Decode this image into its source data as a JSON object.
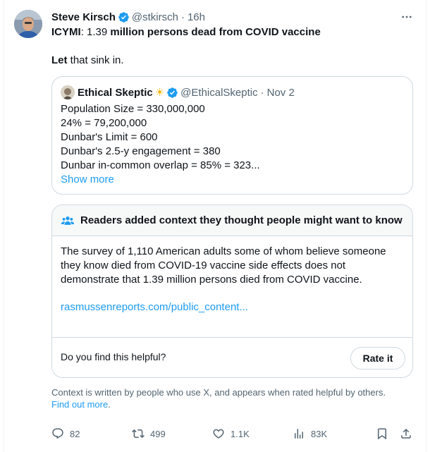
{
  "tweet": {
    "author_name": "Steve Kirsch",
    "handle": "@stkirsch",
    "separator": "·",
    "time": "16h",
    "line1_a": "ICYMI",
    "line1_b": ": 1.39 ",
    "line1_c": "million persons dead from COVID vaccine",
    "line2_a": "Let",
    "line2_b": " that sink in."
  },
  "quote": {
    "author_name": "Ethical Skeptic",
    "emoji": "☀",
    "handle": "@EthicalSkeptic",
    "separator": "·",
    "date": "Nov 2",
    "lines": [
      "Population Size = 330,000,000",
      "24% = 79,200,000",
      "Dunbar's Limit  = 600",
      "Dunbar's 2.5-y engagement = 380",
      "Dunbar in-common overlap = 85% = 323..."
    ],
    "show_more": "Show more"
  },
  "community_note": {
    "title": "Readers added context they thought people might want to know",
    "body_lines": [
      "The survey of 1,110 American adults some of whom believe  someone",
      "they know died from COVID-19 vaccine side effects does not",
      "demonstrate that  1.39 million persons died from COVID vaccine."
    ],
    "link": "rasmussenreports.com/public_content...",
    "helpful_question": "Do you find this helpful?",
    "rate_button": "Rate it"
  },
  "footnote": {
    "text": "Context is written by people who use X, and appears when rated helpful by others.",
    "link": "Find out more",
    "end": "."
  },
  "actions": {
    "replies": "82",
    "reposts": "499",
    "likes": "1.1K",
    "views": "83K"
  },
  "colors": {
    "accent": "#1d9bf0",
    "secondary_text": "#536471",
    "border": "#cfd9de",
    "note_header_bg": "#f7f9f9"
  },
  "icons": [
    "verified-badge-icon",
    "more-icon",
    "community-notes-icon",
    "reply-icon",
    "repost-icon",
    "like-icon",
    "views-icon",
    "bookmark-icon",
    "share-icon"
  ]
}
